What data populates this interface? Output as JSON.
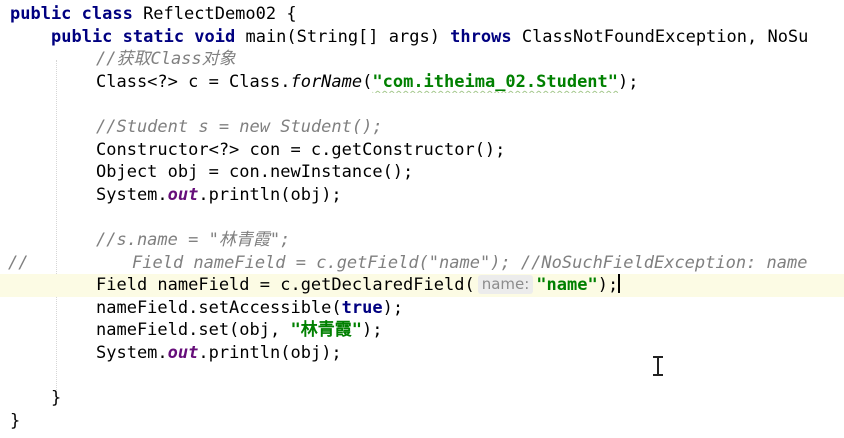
{
  "editor": {
    "lines": [
      {
        "t1": "public class ",
        "t2": "ReflectDemo02 {"
      },
      {
        "t1": "public static void ",
        "t2": "main(String[] args) ",
        "t3": "throws ",
        "t4": "ClassNotFoundException, NoSu"
      },
      {
        "c": "//获取Class对象"
      },
      {
        "t1": "Class<?> c = Class.",
        "t2": "forName",
        "t3": "(",
        "t4": "\"com.itheima_02.Student\"",
        "t5": ");"
      },
      {},
      {
        "c": "//Student s = new Student();"
      },
      {
        "t1": "Constructor<?> con = c.getConstructor();"
      },
      {
        "t1": "Object obj = con.newInstance();"
      },
      {
        "t1": "System.",
        "t2": "out",
        "t3": ".println(obj);"
      },
      {},
      {
        "c": "//s.name = \"林青霞\";"
      },
      {
        "g": "//",
        "c": "Field nameField = c.getField(\"name\"); //NoSuchFieldException: name"
      },
      {
        "t1": "Field nameField = c.getDeclaredField(",
        "hint": "name:",
        "t2": "\"name\"",
        "t3": ");"
      },
      {
        "t1": "nameField.setAccessible(",
        "t2": "true",
        "t3": ");"
      },
      {
        "t1": "nameField.set(obj, ",
        "t2": "\"林青霞\"",
        "t3": ");"
      },
      {
        "t1": "System.",
        "t2": "out",
        "t3": ".println(obj);"
      },
      {},
      {
        "t1": "}"
      },
      {
        "t1": "}"
      }
    ]
  }
}
